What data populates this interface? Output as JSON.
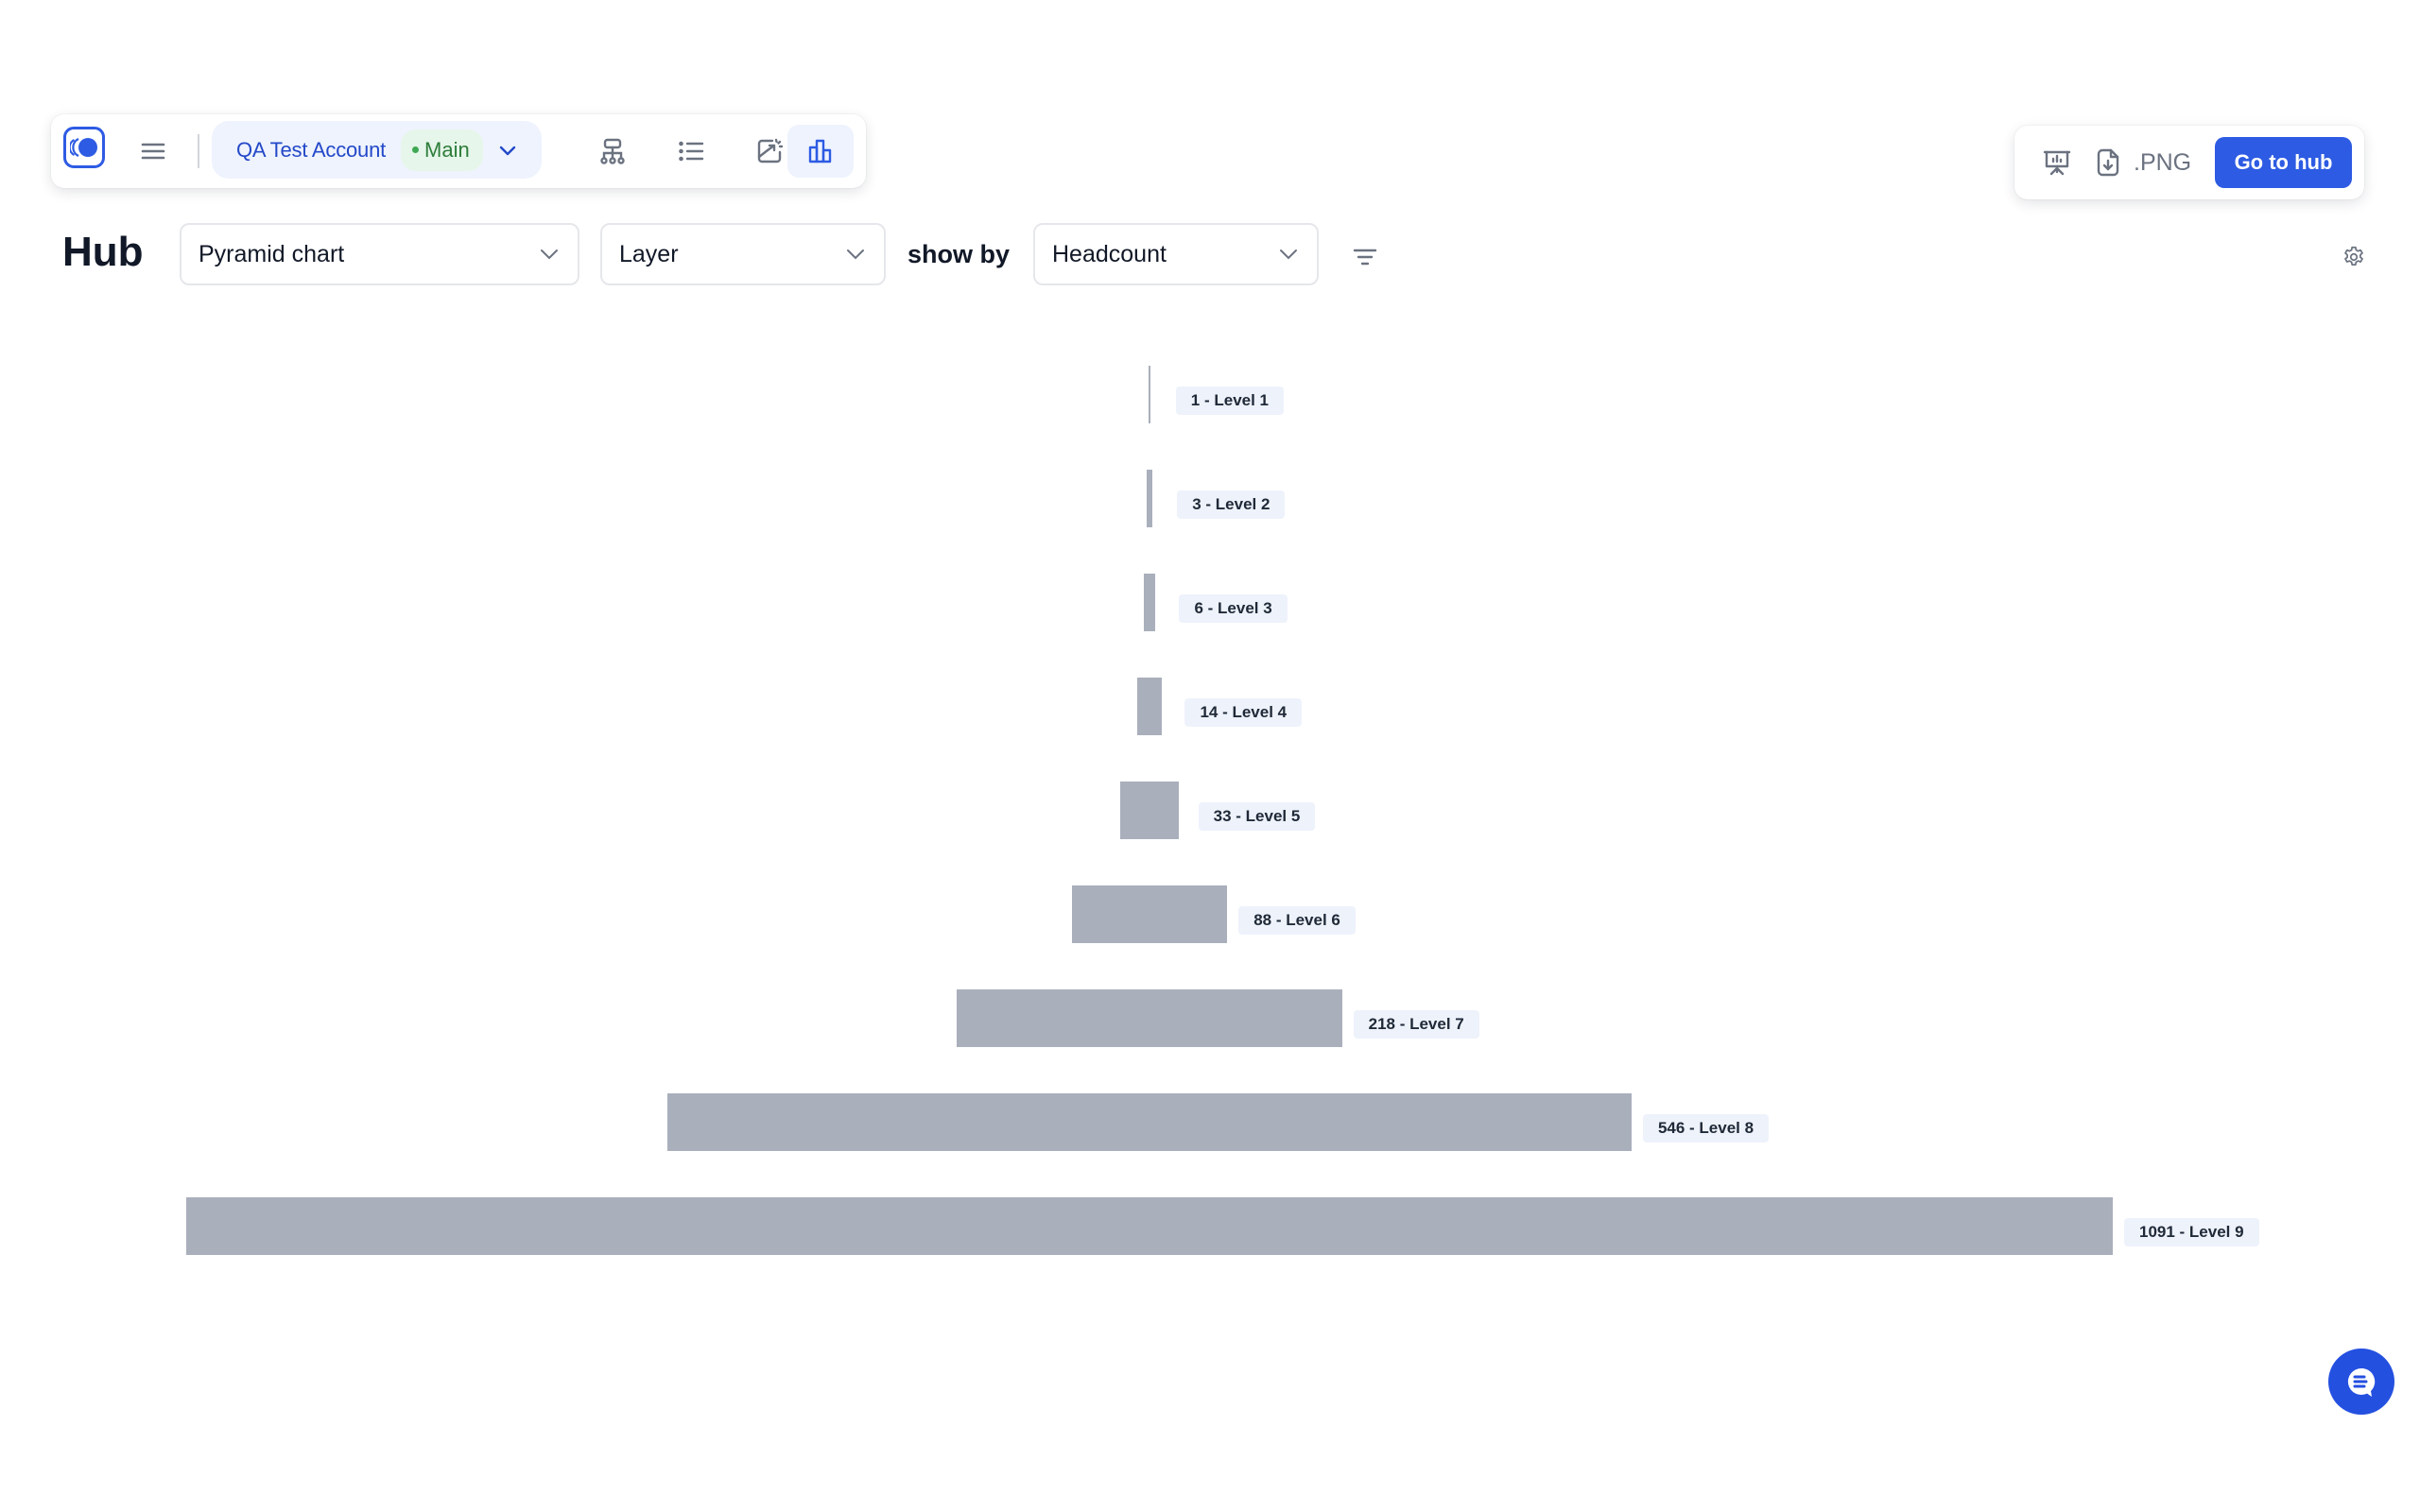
{
  "toolbar": {
    "account_name": "QA Test Account",
    "environment": "Main",
    "icons": [
      "logo-icon",
      "menu-icon",
      "org-chart-icon",
      "list-icon",
      "export-image-icon",
      "bar-chart-icon"
    ]
  },
  "actions": {
    "present_icon": "presentation-icon",
    "png_label": ".PNG",
    "go_to_hub_label": "Go to hub"
  },
  "header": {
    "title": "Hub",
    "chart_type": "Pyramid chart",
    "group_by": "Layer",
    "show_by_label": "show by",
    "metric": "Headcount"
  },
  "colors": {
    "accent": "#2d5be3",
    "bar": "#a9afbb",
    "label_bg": "#eef2fb",
    "env_badge_text": "#2e7d3a"
  },
  "chart_data": {
    "type": "bar",
    "orientation": "horizontal-centered-pyramid",
    "title": "",
    "xlabel": "",
    "ylabel": "",
    "categories": [
      "Level 1",
      "Level 2",
      "Level 3",
      "Level 4",
      "Level 5",
      "Level 6",
      "Level 7",
      "Level 8",
      "Level 9"
    ],
    "values": [
      1,
      3,
      6,
      14,
      33,
      88,
      218,
      546,
      1091
    ],
    "labels": [
      "1 - Level 1",
      "3 - Level 2",
      "6 - Level 3",
      "14 - Level 4",
      "33 - Level 5",
      "88 - Level 6",
      "218 - Level 7",
      "546 - Level 8",
      "1091 - Level 9"
    ],
    "grid": false,
    "legend": "none"
  }
}
